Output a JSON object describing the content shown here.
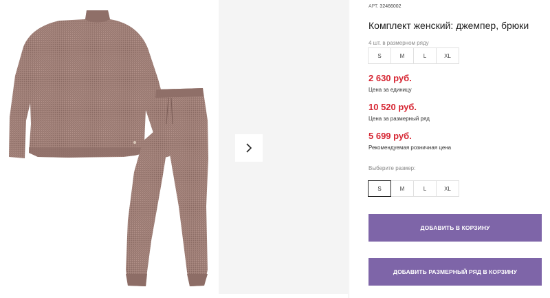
{
  "product": {
    "article_label": "АРТ.",
    "article_number": "32466002",
    "title": "Комплект женский: джемпер, брюки",
    "row_hint": "4 шт. в размерном ряду",
    "row_sizes": [
      "S",
      "M",
      "L",
      "XL"
    ],
    "prices": [
      {
        "value": "2 630 руб.",
        "label": "Цена за единицу"
      },
      {
        "value": "10 520 руб.",
        "label": "Цена за размерный ряд"
      },
      {
        "value": "5 699 руб.",
        "label": "Рекомендуемая розничная цена"
      }
    ],
    "choose_label": "Выберите размер:",
    "sizes": [
      "S",
      "M",
      "L",
      "XL"
    ],
    "selected_size": "S",
    "add_to_cart": "ДОБАВИТЬ В КОРЗИНУ",
    "add_row_to_cart": "ДОБАВИТЬ РАЗМЕРНЫЙ РЯД В КОРЗИНУ"
  },
  "colors": {
    "price": "#d62532",
    "button": "#7e65a8",
    "garment": "#9a7a72"
  },
  "icons": {
    "gallery_next": "chevron-right-icon"
  }
}
